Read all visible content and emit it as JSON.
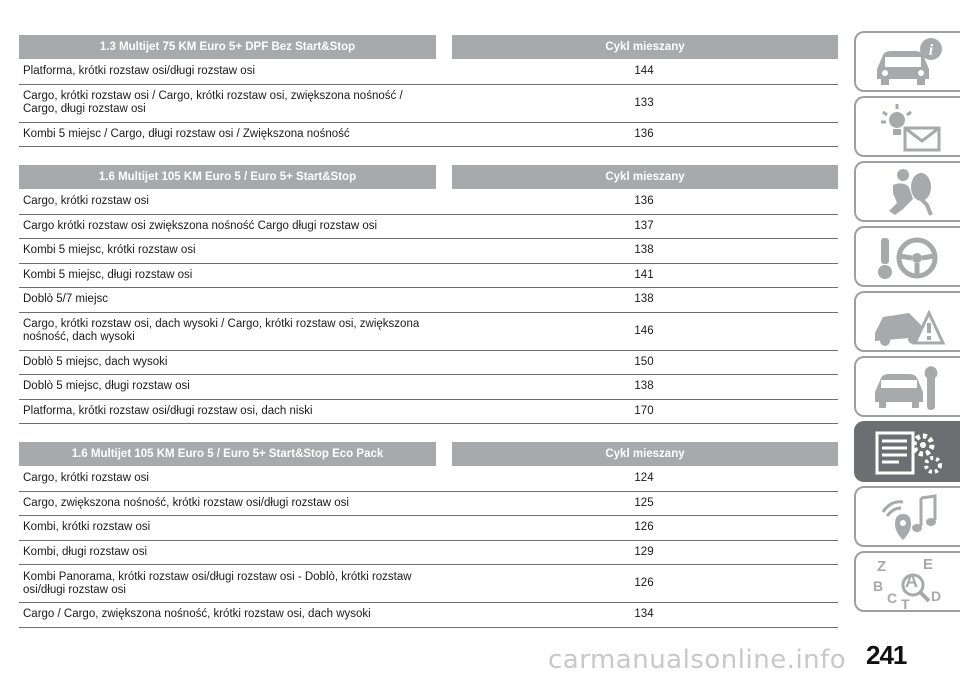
{
  "tables": [
    {
      "header": {
        "engine": "1.3 Multijet 75 KM Euro 5+ DPF Bez Start&Stop",
        "cycle": "Cykl mieszany"
      },
      "rows": [
        {
          "label": "Platforma, krótki rozstaw osi/długi rozstaw osi",
          "value": "144"
        },
        {
          "label": "Cargo, krótki rozstaw osi / Cargo, krótki rozstaw osi, zwiększona nośność / Cargo, długi rozstaw osi",
          "value": "133"
        },
        {
          "label": "Kombi 5 miejsc / Cargo, długi rozstaw osi / Zwiększona nośność",
          "value": "136"
        }
      ]
    },
    {
      "header": {
        "engine": "1.6 Multijet 105 KM Euro 5 / Euro 5+ Start&Stop",
        "cycle": "Cykl mieszany"
      },
      "rows": [
        {
          "label": "Cargo, krótki rozstaw osi",
          "value": "136"
        },
        {
          "label": "Cargo krótki rozstaw osi zwiększona nośność Cargo długi rozstaw osi",
          "value": "137"
        },
        {
          "label": "Kombi 5 miejsc, krótki rozstaw osi",
          "value": "138"
        },
        {
          "label": "Kombi 5 miejsc, długi rozstaw osi",
          "value": "141"
        },
        {
          "label": "Doblò 5/7 miejsc",
          "value": "138"
        },
        {
          "label": "Cargo, krótki rozstaw osi, dach wysoki / Cargo, krótki rozstaw osi, zwiększona nośność, dach wysoki",
          "value": "146"
        },
        {
          "label": "Doblò 5 miejsc, dach wysoki",
          "value": "150"
        },
        {
          "label": "Doblò 5 miejsc, długi rozstaw osi",
          "value": "138"
        },
        {
          "label": "Platforma, krótki rozstaw osi/długi rozstaw osi, dach niski",
          "value": "170"
        }
      ]
    },
    {
      "header": {
        "engine": "1.6 Multijet 105 KM Euro 5 / Euro 5+ Start&Stop Eco Pack",
        "cycle": "Cykl mieszany"
      },
      "rows": [
        {
          "label": "Cargo, krótki rozstaw osi",
          "value": "124"
        },
        {
          "label": "Cargo, zwiększona nośność, krótki rozstaw osi/długi rozstaw osi",
          "value": "125"
        },
        {
          "label": "Kombi, krótki rozstaw osi",
          "value": "126"
        },
        {
          "label": "Kombi, długi rozstaw osi",
          "value": "129"
        },
        {
          "label": "Kombi Panorama, krótki rozstaw osi/długi rozstaw osi - Doblò, krótki rozstaw osi/długi rozstaw osi",
          "value": "126"
        },
        {
          "label": "Cargo / Cargo, zwiększona nośność, krótki rozstaw osi, dach wysoki",
          "value": "134"
        }
      ]
    }
  ],
  "sidebar": {
    "tabs": [
      {
        "icon": "car-info-icon"
      },
      {
        "icon": "warning-lights-icon"
      },
      {
        "icon": "safety-airbag-icon"
      },
      {
        "icon": "steering-wheel-icon"
      },
      {
        "icon": "emergency-icon"
      },
      {
        "icon": "car-maintenance-icon"
      },
      {
        "icon": "technical-data-icon",
        "active": true
      },
      {
        "icon": "multimedia-icon"
      },
      {
        "icon": "index-icon",
        "letters": [
          "Z",
          "E",
          "A",
          "B",
          "C",
          "D",
          "T"
        ]
      }
    ]
  },
  "page_number": "241",
  "watermark": "carmanualsonline.info",
  "colors": {
    "header_bg": "#a7a9ab",
    "active_tab": "#6d6e71",
    "rule": "#6f6f6f"
  }
}
